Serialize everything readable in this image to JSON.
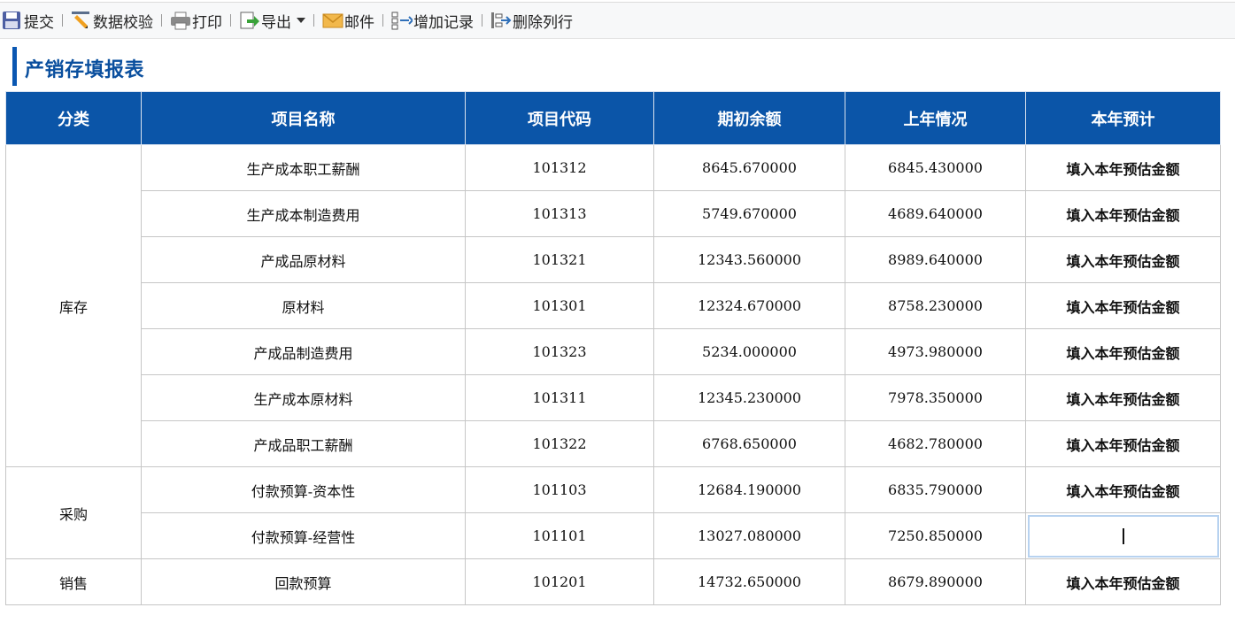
{
  "toolbar": {
    "submit": "提交",
    "validate": "数据校验",
    "print": "打印",
    "export": "导出",
    "mail": "邮件",
    "add_record": "增加记录",
    "delete_row": "删除列行"
  },
  "page": {
    "title": "产销存填报表"
  },
  "table": {
    "headers": [
      "分类",
      "项目名称",
      "项目代码",
      "期初余额",
      "上年情况",
      "本年预计"
    ],
    "placeholder": "填入本年预估金额",
    "categories": [
      "库存",
      "采购",
      "销售"
    ],
    "rows": [
      {
        "name": "生产成本职工薪酬",
        "code": "101312",
        "opening": "8645.670000",
        "last_year": "6845.430000"
      },
      {
        "name": "生产成本制造费用",
        "code": "101313",
        "opening": "5749.670000",
        "last_year": "4689.640000"
      },
      {
        "name": "产成品原材料",
        "code": "101321",
        "opening": "12343.560000",
        "last_year": "8989.640000"
      },
      {
        "name": "原材料",
        "code": "101301",
        "opening": "12324.670000",
        "last_year": "8758.230000"
      },
      {
        "name": "产成品制造费用",
        "code": "101323",
        "opening": "5234.000000",
        "last_year": "4973.980000"
      },
      {
        "name": "生产成本原材料",
        "code": "101311",
        "opening": "12345.230000",
        "last_year": "7978.350000"
      },
      {
        "name": "产成品职工薪酬",
        "code": "101322",
        "opening": "6768.650000",
        "last_year": "4682.780000"
      },
      {
        "name": "付款预算-资本性",
        "code": "101103",
        "opening": "12684.190000",
        "last_year": "6835.790000"
      },
      {
        "name": "付款预算-经营性",
        "code": "101101",
        "opening": "13027.080000",
        "last_year": "7250.850000"
      },
      {
        "name": "回款预算",
        "code": "101201",
        "opening": "14732.650000",
        "last_year": "8679.890000"
      }
    ]
  },
  "colors": {
    "header_bg": "#0b55a8",
    "title": "#0a4f9e",
    "placeholder": "#cbcbcb",
    "active_border": "#b7d2f0"
  }
}
